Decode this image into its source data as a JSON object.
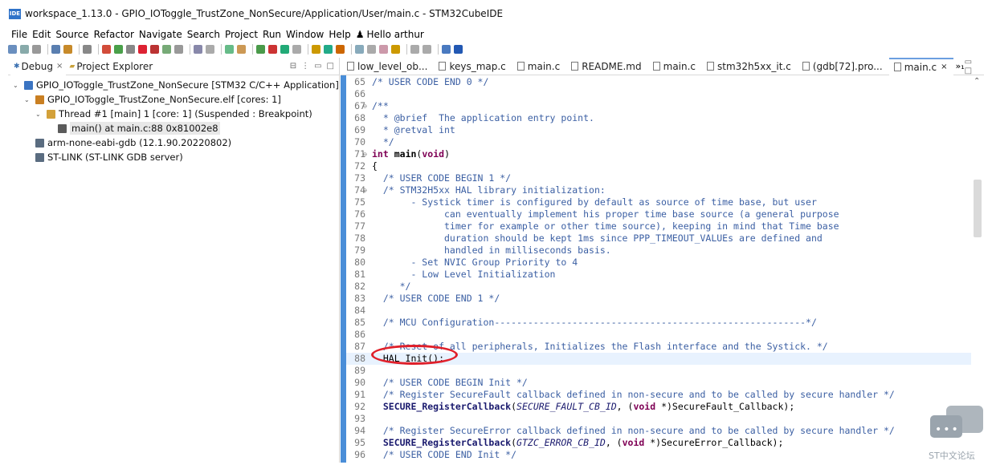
{
  "window": {
    "icon_text": "IDE",
    "title": "workspace_1.13.0 - GPIO_IOToggle_TrustZone_NonSecure/Application/User/main.c - STM32CubeIDE"
  },
  "menu": [
    "File",
    "Edit",
    "Source",
    "Refactor",
    "Navigate",
    "Search",
    "Project",
    "Run",
    "Window",
    "Help"
  ],
  "user": {
    "icon": "person-icon",
    "label": "Hello arthur"
  },
  "left_views": {
    "tabs": [
      {
        "label": "Debug",
        "close": "×"
      },
      {
        "label": "Project Explorer"
      }
    ]
  },
  "debug_tree": [
    {
      "label": "GPIO_IOToggle_TrustZone_NonSecure [STM32 C/C++ Application]",
      "twisty": "⌄",
      "icon": "app-icon",
      "color": "#3b74c2"
    },
    {
      "label": "GPIO_IOToggle_TrustZone_NonSecure.elf [cores: 1]",
      "twisty": "⌄",
      "icon": "elf-icon",
      "color": "#c97f22"
    },
    {
      "label": "Thread #1 [main] 1 [core: 1] (Suspended : Breakpoint)",
      "twisty": "⌄",
      "icon": "thread-icon",
      "color": "#d3a13a"
    },
    {
      "label": "main() at main.c:88 0x81002e8",
      "twisty": "",
      "icon": "stack-frame-icon",
      "color": "#5b5b5b"
    },
    {
      "label": "arm-none-eabi-gdb (12.1.90.20220802)",
      "twisty": "",
      "icon": "gdb-icon",
      "color": "#5a6c80"
    },
    {
      "label": "ST-LINK (ST-LINK GDB server)",
      "twisty": "",
      "icon": "stlink-icon",
      "color": "#5a6c80"
    }
  ],
  "editor_tabs": [
    {
      "label": "low_level_ob..."
    },
    {
      "label": "keys_map.c"
    },
    {
      "label": "main.c"
    },
    {
      "label": "README.md"
    },
    {
      "label": "main.c"
    },
    {
      "label": "stm32h5xx_it.c"
    },
    {
      "label": "(gdb[72].pro..."
    },
    {
      "label": "main.c",
      "active": true,
      "close": "×"
    }
  ],
  "editor_more": "»₁",
  "code_lines": [
    {
      "n": "65",
      "t": "/* USER CODE END 0 */"
    },
    {
      "n": "66",
      "t": ""
    },
    {
      "n": "67",
      "t": "/**",
      "fold": true
    },
    {
      "n": "68",
      "t": "  * @brief  The application entry point."
    },
    {
      "n": "69",
      "t": "  * @retval int"
    },
    {
      "n": "70",
      "t": "  */"
    },
    {
      "n": "71",
      "t": "int main(void)",
      "fold": true,
      "kind": "sig"
    },
    {
      "n": "72",
      "t": "{",
      "kind": "plain"
    },
    {
      "n": "73",
      "t": "  /* USER CODE BEGIN 1 */"
    },
    {
      "n": "74",
      "t": "  /* STM32H5xx HAL library initialization:",
      "fold": true
    },
    {
      "n": "75",
      "t": "       - Systick timer is configured by default as source of time base, but user"
    },
    {
      "n": "76",
      "t": "             can eventually implement his proper time base source (a general purpose"
    },
    {
      "n": "77",
      "t": "             timer for example or other time source), keeping in mind that Time base"
    },
    {
      "n": "78",
      "t": "             duration should be kept 1ms since PPP_TIMEOUT_VALUEs are defined and"
    },
    {
      "n": "79",
      "t": "             handled in milliseconds basis."
    },
    {
      "n": "80",
      "t": "       - Set NVIC Group Priority to 4"
    },
    {
      "n": "81",
      "t": "       - Low Level Initialization"
    },
    {
      "n": "82",
      "t": "     */"
    },
    {
      "n": "83",
      "t": "  /* USER CODE END 1 */"
    },
    {
      "n": "84",
      "t": ""
    },
    {
      "n": "85",
      "t": "  /* MCU Configuration--------------------------------------------------------*/"
    },
    {
      "n": "86",
      "t": ""
    },
    {
      "n": "87",
      "t": "  /* Reset of all peripherals, Initializes the Flash interface and the Systick. */"
    },
    {
      "n": "88",
      "t": "  HAL_Init();",
      "kind": "call",
      "current": true
    },
    {
      "n": "89",
      "t": ""
    },
    {
      "n": "90",
      "t": "  /* USER CODE BEGIN Init */"
    },
    {
      "n": "91",
      "t": "  /* Register SecureFault callback defined in non-secure and to be called by secure handler */"
    },
    {
      "n": "92",
      "t": "  SECURE_RegisterCallback(SECURE_FAULT_CB_ID, (void *)SecureFault_Callback);",
      "kind": "secure"
    },
    {
      "n": "93",
      "t": ""
    },
    {
      "n": "94",
      "t": "  /* Register SecureError callback defined in non-secure and to be called by secure handler */"
    },
    {
      "n": "95",
      "t": "  SECURE_RegisterCallback(GTZC_ERROR_CB_ID, (void *)SecureError_Callback);",
      "kind": "secure"
    },
    {
      "n": "96",
      "t": "  /* USER CODE END Init */"
    }
  ],
  "watermark": {
    "text": "ST中文论坛",
    "icon": "chat-bubble-icon"
  },
  "colors": {
    "ruler": "#4a8ed8",
    "annotation": "#e0202a",
    "keyword": "#7f0055",
    "comment": "#3b5fa3"
  }
}
